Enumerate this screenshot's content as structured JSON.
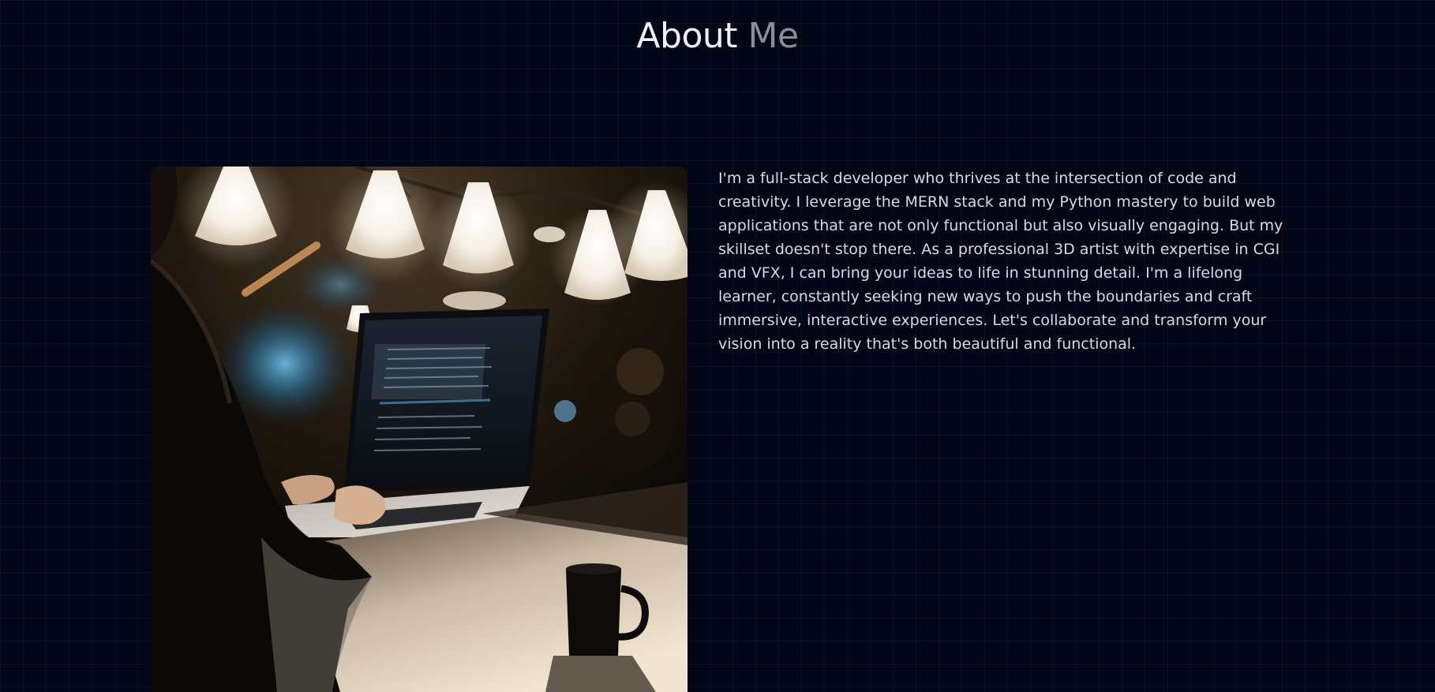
{
  "section": {
    "title_main": "About",
    "title_accent": "Me"
  },
  "photo": {
    "description": "photo-of-person-using-laptop-in-dim-cafe"
  },
  "bio": {
    "text": "I'm a full-stack developer who thrives at the intersection of code and creativity. I leverage the MERN stack and my Python mastery to build web applications that are not only functional but also visually engaging. But my skillset doesn't stop there. As a professional 3D artist with expertise in CGI and VFX, I can bring your ideas to life in stunning detail. I'm a lifelong learner, constantly seeking new ways to push the boundaries and craft immersive, interactive experiences. Let's collaborate and transform your vision into a reality that's both beautiful and functional."
  },
  "colors": {
    "background": "#030617",
    "grid": "#1a1d2c",
    "heading": "#eef0f6",
    "heading_accent": "#8a8e99",
    "body_text": "#d7dae2"
  }
}
